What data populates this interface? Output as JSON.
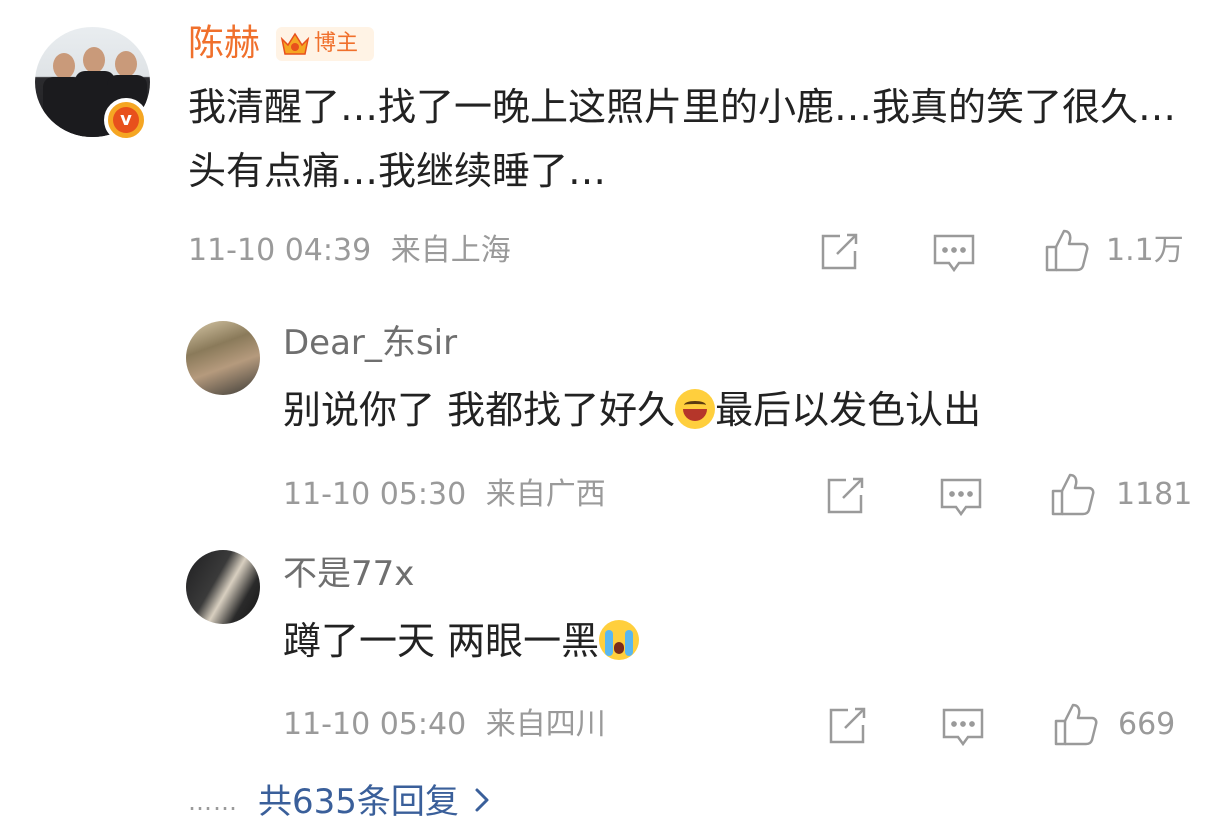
{
  "main_comment": {
    "author": "陈赫",
    "badge_label": "博主",
    "text": "我清醒了…找了一晚上这照片里的小鹿…我真的笑了很久…头有点痛…我继续睡了…",
    "time": "11-10 04:39",
    "location": "来自上海",
    "likes": "1.1万"
  },
  "replies": [
    {
      "author": "Dear_东sir",
      "text_before_emoji": "别说你了 我都找了好久",
      "emoji": "grin-icon",
      "text_after_emoji": "最后以发色认出",
      "time": "11-10 05:30",
      "location": "来自广西",
      "likes": "1181"
    },
    {
      "author": "不是77x",
      "text_before_emoji": "蹲了一天 两眼一黑",
      "emoji": "crying-icon",
      "text_after_emoji": "",
      "time": "11-10 05:40",
      "location": "来自四川",
      "likes": "669"
    }
  ],
  "more_replies": {
    "dots": "……",
    "label": "共635条回复"
  },
  "colors": {
    "author_highlight": "#f0702c",
    "link": "#3a5f9a",
    "meta": "#9a9a9a"
  }
}
